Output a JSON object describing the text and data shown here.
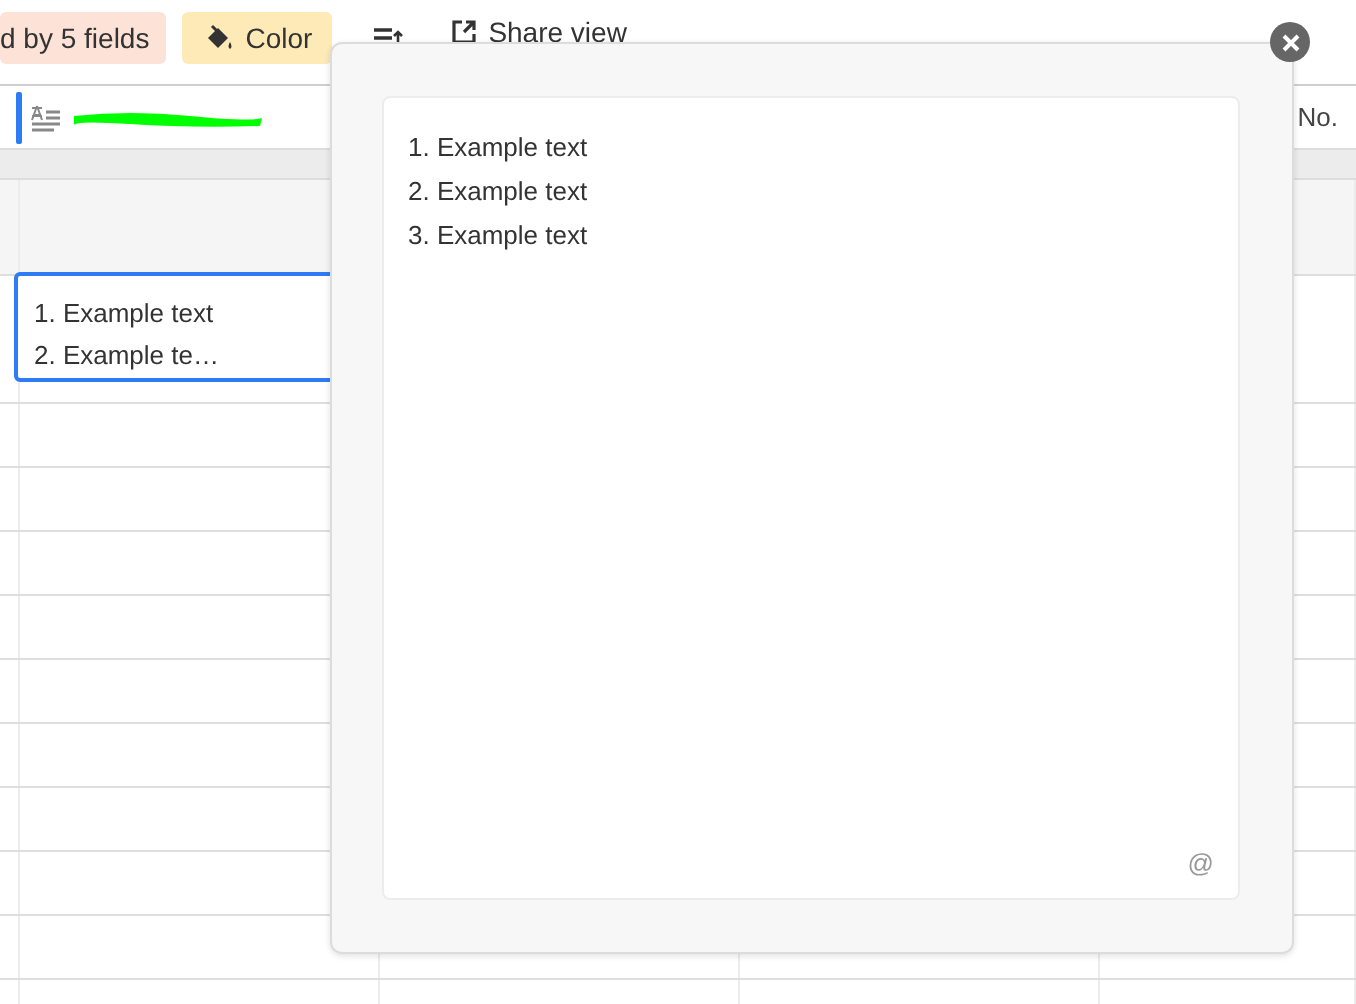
{
  "toolbar": {
    "buttons": [
      {
        "kind": "group",
        "label": "d by 5 fields"
      },
      {
        "kind": "color",
        "label": "Color"
      },
      {
        "kind": "sort"
      },
      {
        "kind": "share",
        "label": "Share view"
      }
    ]
  },
  "grid": {
    "columns": [
      {
        "kind": "redacted"
      },
      {
        "kind": "text",
        "label": "No."
      }
    ],
    "selected_cell": {
      "lines": [
        "1. Example text",
        "2. Example te…"
      ]
    }
  },
  "popup": {
    "lines": [
      "1. Example text",
      "2. Example text",
      "3. Example text"
    ],
    "mention_symbol": "@"
  }
}
